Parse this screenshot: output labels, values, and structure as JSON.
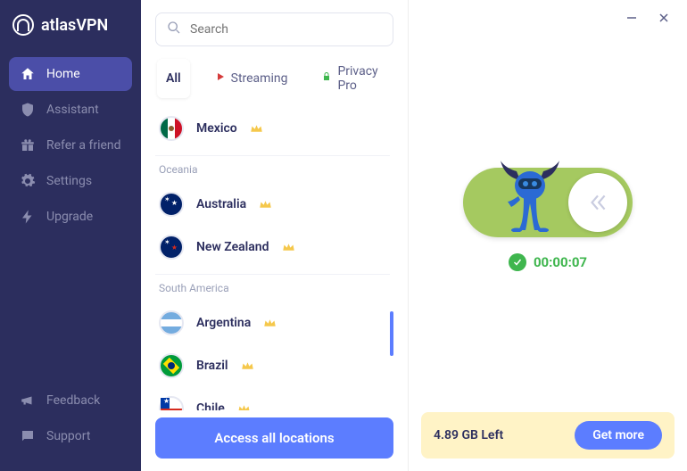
{
  "brand": "atlasVPN",
  "sidebar": {
    "items": [
      {
        "label": "Home",
        "icon": "home-icon",
        "active": true
      },
      {
        "label": "Assistant",
        "icon": "shield-icon"
      },
      {
        "label": "Refer a friend",
        "icon": "gift-icon"
      },
      {
        "label": "Settings",
        "icon": "gear-icon"
      },
      {
        "label": "Upgrade",
        "icon": "bolt-icon"
      }
    ],
    "bottom": [
      {
        "label": "Feedback",
        "icon": "megaphone-icon"
      },
      {
        "label": "Support",
        "icon": "chat-icon"
      }
    ]
  },
  "search": {
    "placeholder": "Search"
  },
  "tabs": [
    {
      "label": "All",
      "active": true
    },
    {
      "label": "Streaming"
    },
    {
      "label": "Privacy Pro"
    }
  ],
  "locations": {
    "free_standing": [
      {
        "name": "Mexico",
        "premium": true,
        "flag": "mx"
      }
    ],
    "groups": [
      {
        "label": "Oceania",
        "items": [
          {
            "name": "Australia",
            "premium": true,
            "flag": "au"
          },
          {
            "name": "New Zealand",
            "premium": true,
            "flag": "nz"
          }
        ]
      },
      {
        "label": "South America",
        "items": [
          {
            "name": "Argentina",
            "premium": true,
            "flag": "ar"
          },
          {
            "name": "Brazil",
            "premium": true,
            "flag": "br"
          },
          {
            "name": "Chile",
            "premium": true,
            "flag": "cl"
          }
        ]
      }
    ]
  },
  "access_button": "Access all locations",
  "connection": {
    "state": "connected",
    "timer": "00:00:07"
  },
  "data": {
    "left_label": "4.89 GB Left",
    "getmore_label": "Get more"
  }
}
